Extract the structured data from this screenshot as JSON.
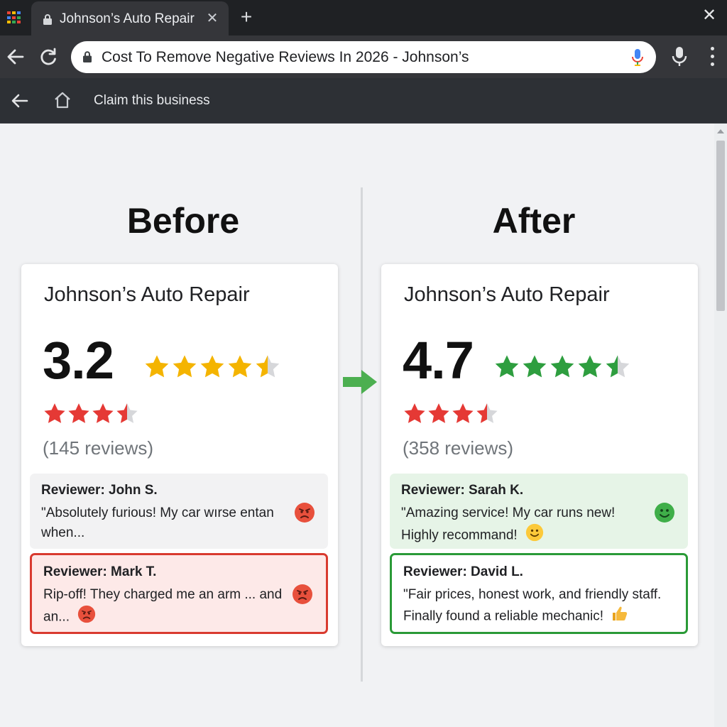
{
  "browser": {
    "tab_title": "Johnson’s Auto Repair",
    "tab_close": "✕",
    "new_tab": "+",
    "window_close": "✕",
    "url": "Cost To Remove Negative Reviews In 2026 - Johnson’s",
    "claim_label": "Claim this business"
  },
  "before": {
    "heading": "Before",
    "business_name": "Johnson’s Auto Repair",
    "rating": "3.2",
    "big_stars": {
      "filled": 4,
      "partial": 0.5,
      "total": 5,
      "color": "#f4b400"
    },
    "small_stars": {
      "filled": 3,
      "partial": 0.5,
      "total": 4,
      "color": "#e53935"
    },
    "review_count": "(145 reviews)",
    "reviews": [
      {
        "reviewer": "Reviewer: John S.",
        "text": "\"Absolutely furious! My car wırse entan when...",
        "sentiment": "angry"
      },
      {
        "reviewer": "Reviewer: Mark T.",
        "text": "Rip-off! They charged me an arm ... and an...",
        "sentiment": "angry"
      }
    ]
  },
  "after": {
    "heading": "After",
    "business_name": "Johnson’s Auto Repair",
    "rating": "4.7",
    "big_stars": {
      "filled": 4,
      "partial": 0.5,
      "total": 5,
      "color": "#2e9e3f"
    },
    "small_stars": {
      "filled": 3,
      "partial": 0.5,
      "total": 4,
      "color": "#e53935"
    },
    "review_count": "(358 reviews)",
    "reviews": [
      {
        "reviewer": "Reviewer: Sarah K.",
        "text": "\"Amazing service! My car runs new! Highly recommand!",
        "sentiment": "happy"
      },
      {
        "reviewer": "Reviewer: David L.",
        "text": "\"Fair prices, honest work, and friendly staff. Finally found a reliable mechanic!",
        "sentiment": "thumbs-up"
      }
    ]
  },
  "icons": {
    "apps": "apps-grid-icon",
    "back": "back-arrow-icon",
    "reload": "reload-icon",
    "lock": "lock-icon",
    "mic": "microphone-icon",
    "menu": "kebab-menu-icon",
    "home": "home-icon",
    "arrow": "right-arrow-icon",
    "angry": "angry-face-icon",
    "happy": "smiley-face-icon",
    "thumbs": "thumbs-up-icon"
  },
  "colors": {
    "star_gold": "#f4b400",
    "star_green": "#2e9e3f",
    "star_red": "#e53935",
    "negative_border": "#d93a2f",
    "positive_border": "#2a9a37",
    "arrow_green": "#4caf50"
  }
}
